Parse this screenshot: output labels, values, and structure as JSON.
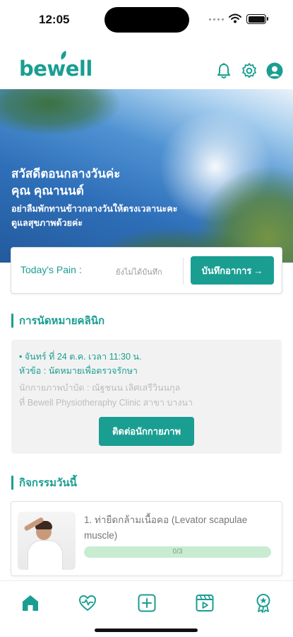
{
  "status_bar": {
    "time": "12:05"
  },
  "header": {
    "logo_text": "bewell"
  },
  "hero": {
    "greeting": "สวัสดีตอนกลางวันค่ะ",
    "name": "คุณ คุณานนต์",
    "message_line1": "อย่าลืมพักทานข้าวกลางวันให้ตรงเวลานะคะ",
    "message_line2": "ดูแลสุขภาพด้วยค่ะ"
  },
  "pain": {
    "label": "Today's Pain :",
    "status": "ยังไม่ได้บันทึก",
    "record_button": "บันทึกอาการ",
    "record_arrow": "→"
  },
  "appointment": {
    "section_title": "การนัดหมายคลินิก",
    "date_line": "• จันทร์ ที่ 24 ต.ค. เวลา 11:30 น.",
    "topic_line": "หัวข้อ : นัดหมายเพื่อตรวจรักษา",
    "therapist_line": "นักกายภาพบำบัด : ณัฐชนน เลิศเสรีวินนกุล",
    "location_line": "ที่ Bewell Physiotheraphy Clinic สาขา บางนา",
    "contact_button": "ติดต่อนักกายภาพ"
  },
  "activities": {
    "section_title": "กิจกรรมวันนี้",
    "items": [
      {
        "title": "1. ท่ายืดกล้ามเนื้อคอ (Levator scapulae muscle)",
        "progress_text": "0/3",
        "progress": 0
      }
    ]
  },
  "bottom_nav": {
    "items": [
      {
        "icon": "home-icon",
        "active": true
      },
      {
        "icon": "heart-pulse-icon",
        "active": false
      },
      {
        "icon": "add-icon",
        "active": false
      },
      {
        "icon": "video-icon",
        "active": false
      },
      {
        "icon": "award-icon",
        "active": false
      }
    ]
  },
  "colors": {
    "primary": "#1a9e92",
    "progress_track": "#c7ecd2",
    "card_gray": "#f2f2f2"
  }
}
